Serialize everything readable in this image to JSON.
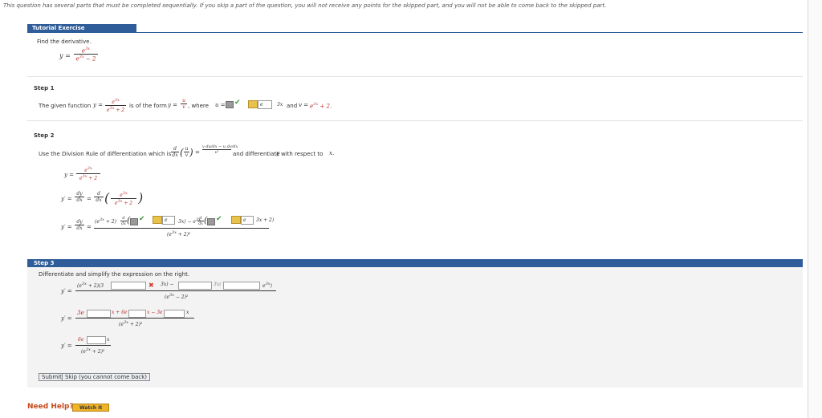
{
  "notice": "This question has several parts that must be completed sequentially. If you skip a part of the question, you will not receive any points for the skipped part, and you will not be able to come back to the skipped part.",
  "tab": {
    "label": "Tutorial Exercise"
  },
  "intro": {
    "instruction": "Find the derivative.",
    "y": "y =",
    "num": "e",
    "num_sup": "3x",
    "den": "e",
    "den_sup": "3x",
    "den_tail": "− 2"
  },
  "step1": {
    "title": "Step 1",
    "text_a": "The given function",
    "y": "y =",
    "num": "e",
    "num_sup": "3x",
    "den": "e",
    "den_sup": "3x",
    "den_tail": "+ 2",
    "text_b": "is of the form",
    "form": "y =",
    "form_num": "u",
    "form_den": "v",
    "text_c": ", where",
    "u_eq": "u =",
    "u_ans": "e",
    "u_ans_sup": "3x",
    "and": "and",
    "v_eq": "v =",
    "v_val": "e",
    "v_sup": "3x",
    "v_tail": "+ 2."
  },
  "step2": {
    "title": "Step 2",
    "text_a": "Use the Division Rule of differentiation which is",
    "rule_d": "d",
    "rule_dx": "dx",
    "rule_u": "u",
    "rule_v": "v",
    "rule_num": "v du/dx − u dv/dx",
    "rule_den": "v²",
    "text_b": "and differentiate",
    "y_var": "y",
    "text_c": "with respect to",
    "x_var": "x.",
    "line1_y": "y =",
    "line1_num": "e",
    "line1_num_sup": "3x",
    "line1_den": "e",
    "line1_den_sup": "3x",
    "line1_den_tail": "+ 2",
    "line2_y": "y′ =",
    "line2_dy": "dy",
    "line2_dx": "dx",
    "line2_eq": "=",
    "line2_d": "d",
    "line2_ddx": "dx",
    "line3_y": "y′ =",
    "line3_dy": "dy",
    "line3_dx": "dx",
    "line3_num_a": "(e",
    "line3_num_a_sup": "3x",
    "line3_num_b": "+ 2)",
    "line3_d1": "d",
    "line3_dx1": "dx",
    "tile1": "e",
    "line3_mid": "3x) − e",
    "line3_mid_sup": "3x",
    "line3_d2": "d",
    "line3_dx2": "dx",
    "tile2": "e",
    "line3_tail": "3x + 2)",
    "line3_den": "(e",
    "line3_den_sup": "3x",
    "line3_den_tail": "+ 2)²"
  },
  "step3": {
    "title": "Step 3",
    "instruction": "Differentiate and simplify the expression on the right.",
    "r1_y": "y′ =",
    "r1_num_a": "(e",
    "r1_num_a_sup": "3x",
    "r1_num_b": "+ 2)(3",
    "r1_mid": "3x) −",
    "r1_box2_tail": "3x(",
    "r1_box3_tail": "e",
    "r1_box3_tail_sup": "3x",
    "r1_close": ")",
    "r1_den": "(e",
    "r1_den_sup": "3x",
    "r1_den_tail": "− 2)²",
    "r2_y": "y′ =",
    "r2_a": "3e",
    "r2_b": "x + 6e",
    "r2_c": "x − 3e",
    "r2_d": "x",
    "r2_den": "(e",
    "r2_den_sup": "3x",
    "r2_den_tail": "+ 2)²",
    "r3_y": "y′ =",
    "r3_num": "6e",
    "r3_x": "x",
    "r3_den": "(e",
    "r3_den_sup": "3x",
    "r3_den_tail": "+ 2)²",
    "submit": "Submit",
    "skip": "Skip (you cannot come back)"
  },
  "help": {
    "label": "Need Help?",
    "watch": "Watch It"
  },
  "colors": {
    "accent": "#2f5d99",
    "correct": "#3a9a3a",
    "incorrect": "#d03a2a",
    "tile": "#e8c34a",
    "help": "#c64a1a"
  }
}
